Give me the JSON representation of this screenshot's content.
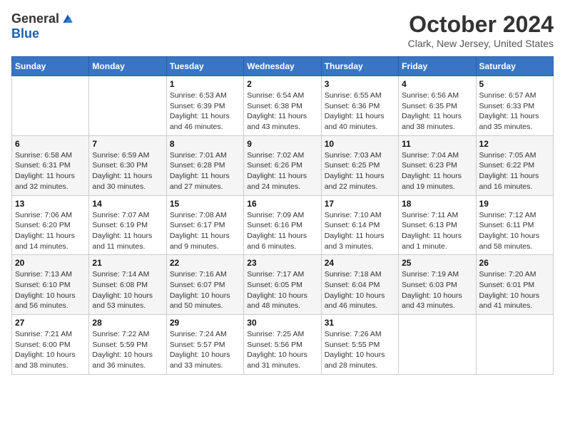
{
  "header": {
    "logo_general": "General",
    "logo_blue": "Blue",
    "month_title": "October 2024",
    "location": "Clark, New Jersey, United States"
  },
  "days_of_week": [
    "Sunday",
    "Monday",
    "Tuesday",
    "Wednesday",
    "Thursday",
    "Friday",
    "Saturday"
  ],
  "weeks": [
    [
      {
        "day": "",
        "sunrise": "",
        "sunset": "",
        "daylight": ""
      },
      {
        "day": "",
        "sunrise": "",
        "sunset": "",
        "daylight": ""
      },
      {
        "day": "1",
        "sunrise": "Sunrise: 6:53 AM",
        "sunset": "Sunset: 6:39 PM",
        "daylight": "Daylight: 11 hours and 46 minutes."
      },
      {
        "day": "2",
        "sunrise": "Sunrise: 6:54 AM",
        "sunset": "Sunset: 6:38 PM",
        "daylight": "Daylight: 11 hours and 43 minutes."
      },
      {
        "day": "3",
        "sunrise": "Sunrise: 6:55 AM",
        "sunset": "Sunset: 6:36 PM",
        "daylight": "Daylight: 11 hours and 40 minutes."
      },
      {
        "day": "4",
        "sunrise": "Sunrise: 6:56 AM",
        "sunset": "Sunset: 6:35 PM",
        "daylight": "Daylight: 11 hours and 38 minutes."
      },
      {
        "day": "5",
        "sunrise": "Sunrise: 6:57 AM",
        "sunset": "Sunset: 6:33 PM",
        "daylight": "Daylight: 11 hours and 35 minutes."
      }
    ],
    [
      {
        "day": "6",
        "sunrise": "Sunrise: 6:58 AM",
        "sunset": "Sunset: 6:31 PM",
        "daylight": "Daylight: 11 hours and 32 minutes."
      },
      {
        "day": "7",
        "sunrise": "Sunrise: 6:59 AM",
        "sunset": "Sunset: 6:30 PM",
        "daylight": "Daylight: 11 hours and 30 minutes."
      },
      {
        "day": "8",
        "sunrise": "Sunrise: 7:01 AM",
        "sunset": "Sunset: 6:28 PM",
        "daylight": "Daylight: 11 hours and 27 minutes."
      },
      {
        "day": "9",
        "sunrise": "Sunrise: 7:02 AM",
        "sunset": "Sunset: 6:26 PM",
        "daylight": "Daylight: 11 hours and 24 minutes."
      },
      {
        "day": "10",
        "sunrise": "Sunrise: 7:03 AM",
        "sunset": "Sunset: 6:25 PM",
        "daylight": "Daylight: 11 hours and 22 minutes."
      },
      {
        "day": "11",
        "sunrise": "Sunrise: 7:04 AM",
        "sunset": "Sunset: 6:23 PM",
        "daylight": "Daylight: 11 hours and 19 minutes."
      },
      {
        "day": "12",
        "sunrise": "Sunrise: 7:05 AM",
        "sunset": "Sunset: 6:22 PM",
        "daylight": "Daylight: 11 hours and 16 minutes."
      }
    ],
    [
      {
        "day": "13",
        "sunrise": "Sunrise: 7:06 AM",
        "sunset": "Sunset: 6:20 PM",
        "daylight": "Daylight: 11 hours and 14 minutes."
      },
      {
        "day": "14",
        "sunrise": "Sunrise: 7:07 AM",
        "sunset": "Sunset: 6:19 PM",
        "daylight": "Daylight: 11 hours and 11 minutes."
      },
      {
        "day": "15",
        "sunrise": "Sunrise: 7:08 AM",
        "sunset": "Sunset: 6:17 PM",
        "daylight": "Daylight: 11 hours and 9 minutes."
      },
      {
        "day": "16",
        "sunrise": "Sunrise: 7:09 AM",
        "sunset": "Sunset: 6:16 PM",
        "daylight": "Daylight: 11 hours and 6 minutes."
      },
      {
        "day": "17",
        "sunrise": "Sunrise: 7:10 AM",
        "sunset": "Sunset: 6:14 PM",
        "daylight": "Daylight: 11 hours and 3 minutes."
      },
      {
        "day": "18",
        "sunrise": "Sunrise: 7:11 AM",
        "sunset": "Sunset: 6:13 PM",
        "daylight": "Daylight: 11 hours and 1 minute."
      },
      {
        "day": "19",
        "sunrise": "Sunrise: 7:12 AM",
        "sunset": "Sunset: 6:11 PM",
        "daylight": "Daylight: 10 hours and 58 minutes."
      }
    ],
    [
      {
        "day": "20",
        "sunrise": "Sunrise: 7:13 AM",
        "sunset": "Sunset: 6:10 PM",
        "daylight": "Daylight: 10 hours and 56 minutes."
      },
      {
        "day": "21",
        "sunrise": "Sunrise: 7:14 AM",
        "sunset": "Sunset: 6:08 PM",
        "daylight": "Daylight: 10 hours and 53 minutes."
      },
      {
        "day": "22",
        "sunrise": "Sunrise: 7:16 AM",
        "sunset": "Sunset: 6:07 PM",
        "daylight": "Daylight: 10 hours and 50 minutes."
      },
      {
        "day": "23",
        "sunrise": "Sunrise: 7:17 AM",
        "sunset": "Sunset: 6:05 PM",
        "daylight": "Daylight: 10 hours and 48 minutes."
      },
      {
        "day": "24",
        "sunrise": "Sunrise: 7:18 AM",
        "sunset": "Sunset: 6:04 PM",
        "daylight": "Daylight: 10 hours and 46 minutes."
      },
      {
        "day": "25",
        "sunrise": "Sunrise: 7:19 AM",
        "sunset": "Sunset: 6:03 PM",
        "daylight": "Daylight: 10 hours and 43 minutes."
      },
      {
        "day": "26",
        "sunrise": "Sunrise: 7:20 AM",
        "sunset": "Sunset: 6:01 PM",
        "daylight": "Daylight: 10 hours and 41 minutes."
      }
    ],
    [
      {
        "day": "27",
        "sunrise": "Sunrise: 7:21 AM",
        "sunset": "Sunset: 6:00 PM",
        "daylight": "Daylight: 10 hours and 38 minutes."
      },
      {
        "day": "28",
        "sunrise": "Sunrise: 7:22 AM",
        "sunset": "Sunset: 5:59 PM",
        "daylight": "Daylight: 10 hours and 36 minutes."
      },
      {
        "day": "29",
        "sunrise": "Sunrise: 7:24 AM",
        "sunset": "Sunset: 5:57 PM",
        "daylight": "Daylight: 10 hours and 33 minutes."
      },
      {
        "day": "30",
        "sunrise": "Sunrise: 7:25 AM",
        "sunset": "Sunset: 5:56 PM",
        "daylight": "Daylight: 10 hours and 31 minutes."
      },
      {
        "day": "31",
        "sunrise": "Sunrise: 7:26 AM",
        "sunset": "Sunset: 5:55 PM",
        "daylight": "Daylight: 10 hours and 28 minutes."
      },
      {
        "day": "",
        "sunrise": "",
        "sunset": "",
        "daylight": ""
      },
      {
        "day": "",
        "sunrise": "",
        "sunset": "",
        "daylight": ""
      }
    ]
  ]
}
